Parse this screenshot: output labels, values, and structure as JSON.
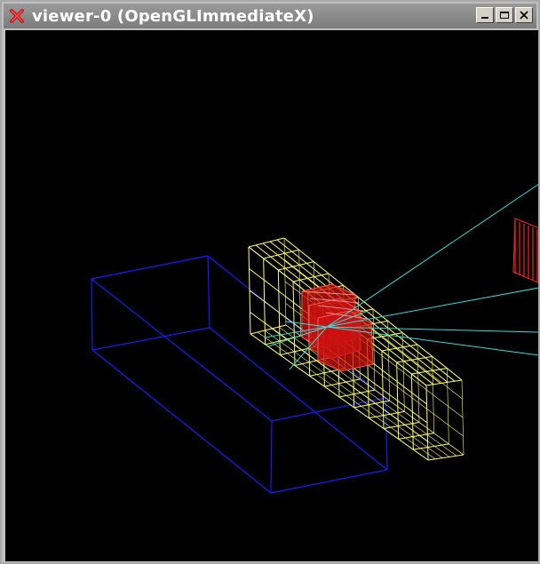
{
  "window": {
    "title": "viewer-0 (OpenGLImmediateX)",
    "icon": "x-app-icon",
    "controls": [
      "minimize",
      "maximize",
      "close"
    ]
  },
  "viewer": {
    "background": "#000000",
    "colors": {
      "detector_box": "#1a1aff",
      "calorimeter_grid": "#ffff66",
      "hit_cells": "#cc1111",
      "tracks": "#33dddd",
      "far_detector": "#ff2222"
    }
  }
}
